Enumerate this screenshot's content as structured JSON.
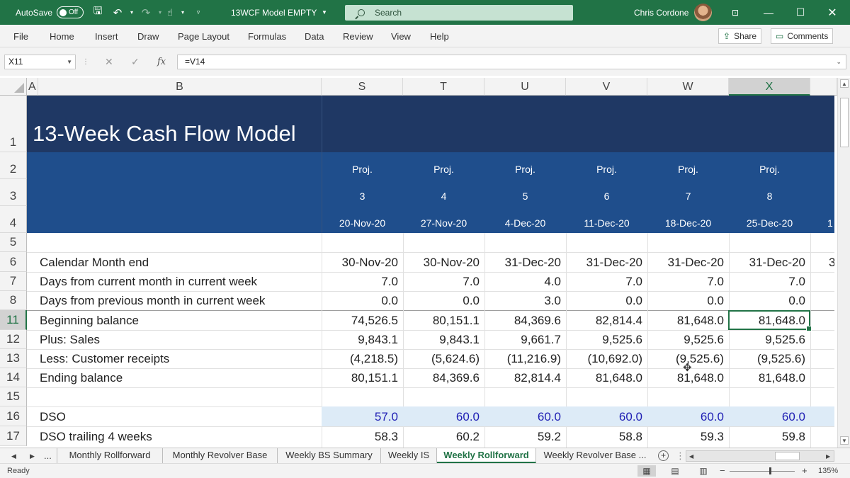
{
  "titlebar": {
    "autosave_label": "AutoSave",
    "autosave_state": "Off",
    "doc_title": "13WCF Model EMPTY",
    "search_placeholder": "Search",
    "user_name": "Chris Cordone"
  },
  "ribbon": {
    "tabs": [
      "File",
      "Home",
      "Insert",
      "Draw",
      "Page Layout",
      "Formulas",
      "Data",
      "Review",
      "View",
      "Help"
    ],
    "share_label": "Share",
    "comments_label": "Comments"
  },
  "formula_bar": {
    "name_box": "X11",
    "fx_label": "fx",
    "formula": "=V14"
  },
  "columns": [
    "A",
    "B",
    "S",
    "T",
    "U",
    "V",
    "W",
    "X"
  ],
  "row_numbers": [
    "1",
    "2",
    "3",
    "4",
    "5",
    "6",
    "7",
    "8",
    "11",
    "12",
    "13",
    "14",
    "15",
    "16",
    "17"
  ],
  "sheet": {
    "title": "13-Week Cash Flow Model",
    "header_proj": [
      "Proj.",
      "Proj.",
      "Proj.",
      "Proj.",
      "Proj.",
      "Proj."
    ],
    "header_week": [
      "3",
      "4",
      "5",
      "6",
      "7",
      "8"
    ],
    "header_dates": [
      "20-Nov-20",
      "27-Nov-20",
      "4-Dec-20",
      "11-Dec-20",
      "18-Dec-20",
      "25-Dec-20"
    ],
    "overflow_row3": "1",
    "overflow_row6": "3",
    "rows": [
      {
        "label": "Calendar Month end",
        "values": [
          "30-Nov-20",
          "30-Nov-20",
          "31-Dec-20",
          "31-Dec-20",
          "31-Dec-20",
          "31-Dec-20"
        ]
      },
      {
        "label": "Days from current month in current week",
        "values": [
          "7.0",
          "7.0",
          "4.0",
          "7.0",
          "7.0",
          "7.0"
        ]
      },
      {
        "label": "Days from previous month in current week",
        "values": [
          "0.0",
          "0.0",
          "3.0",
          "0.0",
          "0.0",
          "0.0"
        ]
      },
      {
        "label": "Beginning balance",
        "values": [
          "74,526.5",
          "80,151.1",
          "84,369.6",
          "82,814.4",
          "81,648.0",
          "81,648.0"
        ]
      },
      {
        "label": "Plus: Sales",
        "values": [
          "9,843.1",
          "9,843.1",
          "9,661.7",
          "9,525.6",
          "9,525.6",
          "9,525.6"
        ]
      },
      {
        "label": "Less: Customer receipts",
        "values": [
          "(4,218.5)",
          "(5,624.6)",
          "(11,216.9)",
          "(10,692.0)",
          "(9,525.6)",
          "(9,525.6)"
        ]
      },
      {
        "label": "Ending balance",
        "values": [
          "80,151.1",
          "84,369.6",
          "82,814.4",
          "81,648.0",
          "81,648.0",
          "81,648.0"
        ]
      },
      {
        "label": "",
        "values": [
          "",
          "",
          "",
          "",
          "",
          ""
        ]
      },
      {
        "label": "DSO",
        "values": [
          "57.0",
          "60.0",
          "60.0",
          "60.0",
          "60.0",
          "60.0"
        ]
      },
      {
        "label": "DSO trailing 4 weeks",
        "values": [
          "58.3",
          "60.2",
          "59.2",
          "58.8",
          "59.3",
          "59.8"
        ]
      }
    ]
  },
  "sheet_tabs": {
    "ellipsis": "...",
    "tabs": [
      "Monthly Rollforward",
      "Monthly Revolver Base",
      "Weekly BS Summary",
      "Weekly IS",
      "Weekly Rollforward",
      "Weekly Revolver Base ..."
    ],
    "active": "Weekly Rollforward"
  },
  "status": {
    "ready": "Ready",
    "zoom": "135%"
  },
  "colors": {
    "excel_green": "#217346",
    "title_band": "#1f3864",
    "header_band": "#1f4e8c",
    "dso_fill": "#ddebf7",
    "dso_text": "#1f1fb4"
  }
}
